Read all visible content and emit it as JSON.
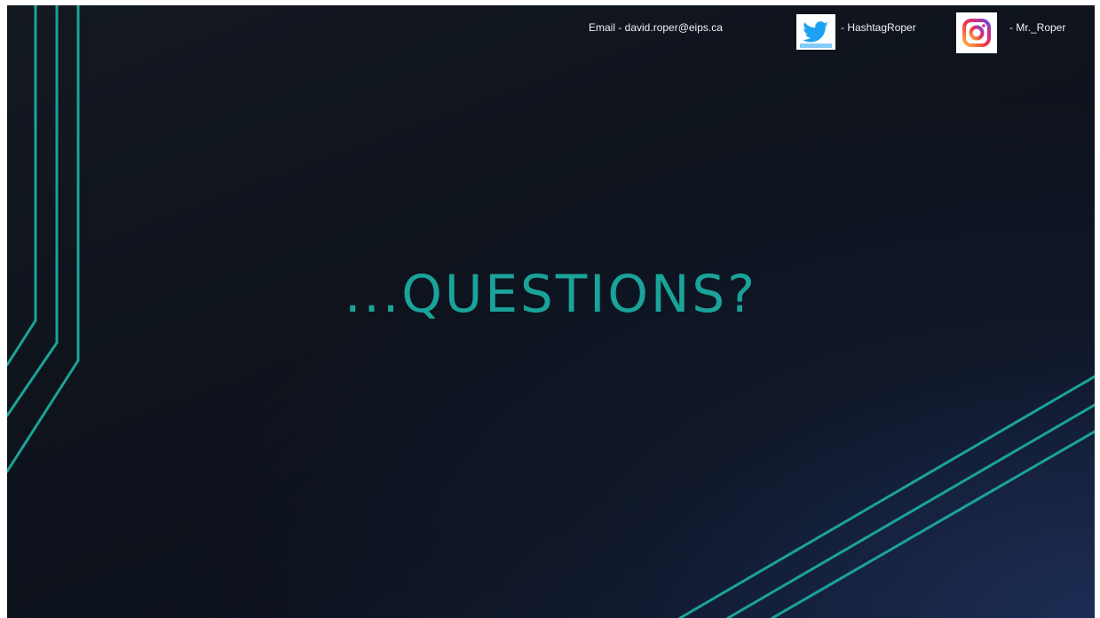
{
  "slide": {
    "contact": {
      "email": "Email - david.roper@eips.ca",
      "twitter_handle": "- HashtagRoper",
      "instagram_handle": "- Mr._Roper"
    },
    "title": "...QUESTIONS?"
  },
  "colors": {
    "accent": "#1aa39a",
    "background": "#0e131c",
    "text": "#f2f2f2",
    "twitter_blue": "#1da1f2"
  },
  "icons": [
    "twitter-icon",
    "instagram-icon"
  ]
}
